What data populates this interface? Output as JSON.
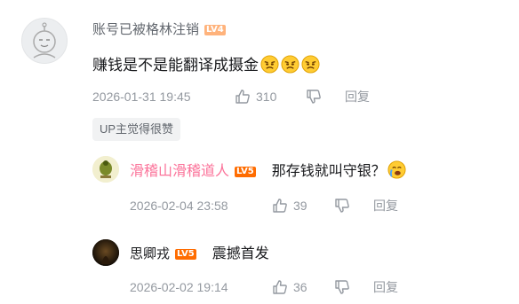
{
  "comment": {
    "username": "账号已被格林注销",
    "level": "LV4",
    "text": "赚钱是不是能翻译成摄金",
    "date": "2026-01-31 19:45",
    "likes": "310",
    "reply_label": "回复",
    "up_tag": "UP主觉得很赞"
  },
  "replies": [
    {
      "username": "滑稽山滑稽道人",
      "level": "LV5",
      "text": "那存钱就叫守银？",
      "date": "2026-02-04 23:58",
      "likes": "39",
      "reply_label": "回复"
    },
    {
      "username": "思卿戎",
      "level": "LV5",
      "text": "震撼首发",
      "date": "2026-02-02 19:14",
      "likes": "36",
      "reply_label": "回复"
    }
  ],
  "colors": {
    "level4": "#ffb37c",
    "level5": "#ff6c00",
    "vip_name": "#fb7299",
    "meta": "#9499a0"
  }
}
